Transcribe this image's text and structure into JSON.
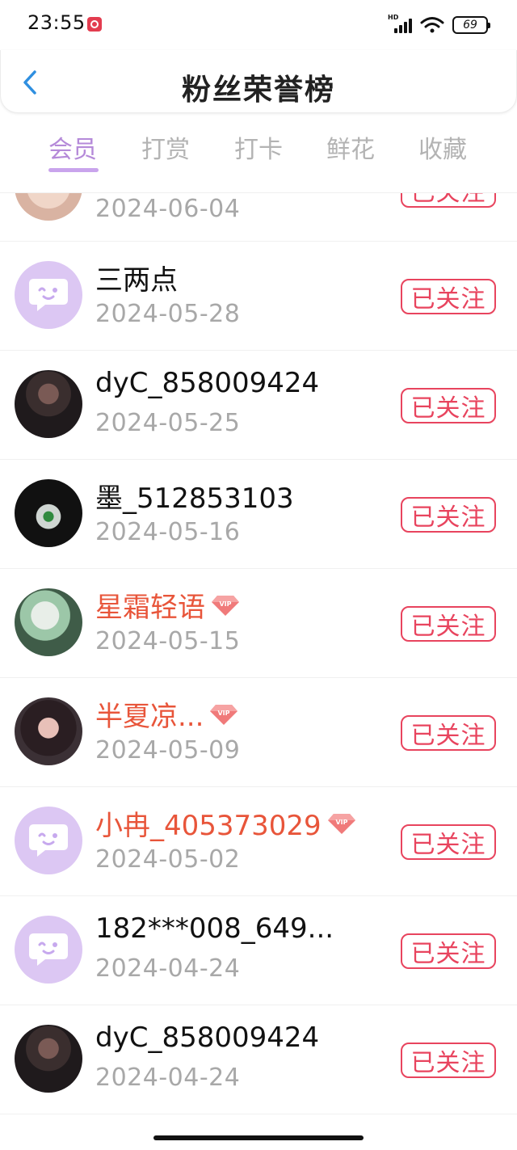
{
  "status_bar": {
    "time": "23:55",
    "battery": "69",
    "network": "HD"
  },
  "header": {
    "title": "粉丝荣誉榜"
  },
  "tabs": [
    {
      "label": "会员",
      "active": true
    },
    {
      "label": "打赏",
      "active": false
    },
    {
      "label": "打卡",
      "active": false
    },
    {
      "label": "鲜花",
      "active": false
    },
    {
      "label": "收藏",
      "active": false
    }
  ],
  "colors": {
    "accent": "#b58ad9",
    "follow": "#e8445e",
    "vip_name": "#e8553a",
    "date": "#a8a8a8"
  },
  "follow_label": "已关注",
  "fans": [
    {
      "name": "",
      "date": "2024-06-04",
      "vip": false,
      "avatar": "photo"
    },
    {
      "name": "三两点",
      "date": "2024-05-28",
      "vip": false,
      "avatar": "default-chat-icon"
    },
    {
      "name": "dyC_858009424",
      "date": "2024-05-25",
      "vip": false,
      "avatar": "photo"
    },
    {
      "name": "墨_512853103",
      "date": "2024-05-16",
      "vip": false,
      "avatar": "photo"
    },
    {
      "name": "星霜轻语",
      "date": "2024-05-15",
      "vip": true,
      "avatar": "photo"
    },
    {
      "name": "半夏凉...",
      "date": "2024-05-09",
      "vip": true,
      "avatar": "photo"
    },
    {
      "name": "小冉_405373029",
      "date": "2024-05-02",
      "vip": true,
      "avatar": "default-chat-icon"
    },
    {
      "name": "182***008_649...",
      "date": "2024-04-24",
      "vip": false,
      "avatar": "default-chat-icon"
    },
    {
      "name": "dyC_858009424",
      "date": "2024-04-24",
      "vip": false,
      "avatar": "photo"
    }
  ],
  "vip_badge_label": "VIP"
}
